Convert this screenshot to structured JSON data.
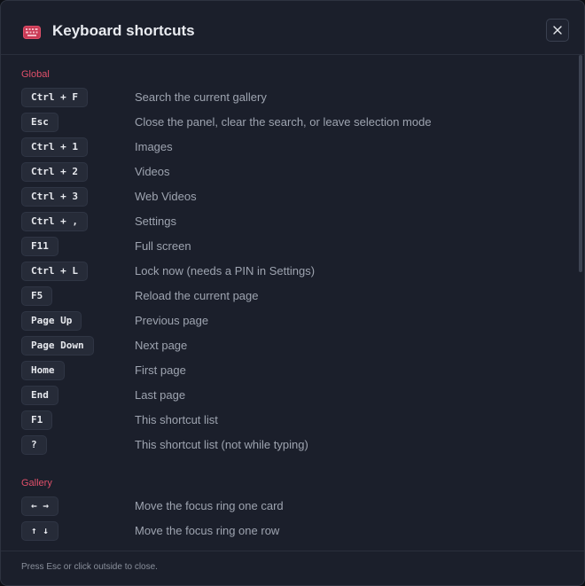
{
  "dialog": {
    "title": "Keyboard shortcuts",
    "icon": "keyboard-icon",
    "close_icon": "close-icon",
    "footer_hint": "Press Esc or click outside to close.",
    "colors": {
      "accent": "#e0506a",
      "background": "#1b1f2b",
      "key_bg": "#262b38"
    }
  },
  "sections": [
    {
      "title": "Global",
      "shortcuts": [
        {
          "key": "Ctrl + F",
          "description": "Search the current gallery"
        },
        {
          "key": "Esc",
          "description": "Close the panel, clear the search, or leave selection mode"
        },
        {
          "key": "Ctrl + 1",
          "description": "Images"
        },
        {
          "key": "Ctrl + 2",
          "description": "Videos"
        },
        {
          "key": "Ctrl + 3",
          "description": "Web Videos"
        },
        {
          "key": "Ctrl + ,",
          "description": "Settings"
        },
        {
          "key": "F11",
          "description": "Full screen"
        },
        {
          "key": "Ctrl + L",
          "description": "Lock now (needs a PIN in Settings)"
        },
        {
          "key": "F5",
          "description": "Reload the current page"
        },
        {
          "key": "Page Up",
          "description": "Previous page"
        },
        {
          "key": "Page Down",
          "description": "Next page"
        },
        {
          "key": "Home",
          "description": "First page"
        },
        {
          "key": "End",
          "description": "Last page"
        },
        {
          "key": "F1",
          "description": "This shortcut list"
        },
        {
          "key": "?",
          "description": "This shortcut list (not while typing)"
        }
      ]
    },
    {
      "title": "Gallery",
      "shortcuts": [
        {
          "key": "← →",
          "description": "Move the focus ring one card"
        },
        {
          "key": "↑ ↓",
          "description": "Move the focus ring one row"
        }
      ]
    }
  ]
}
